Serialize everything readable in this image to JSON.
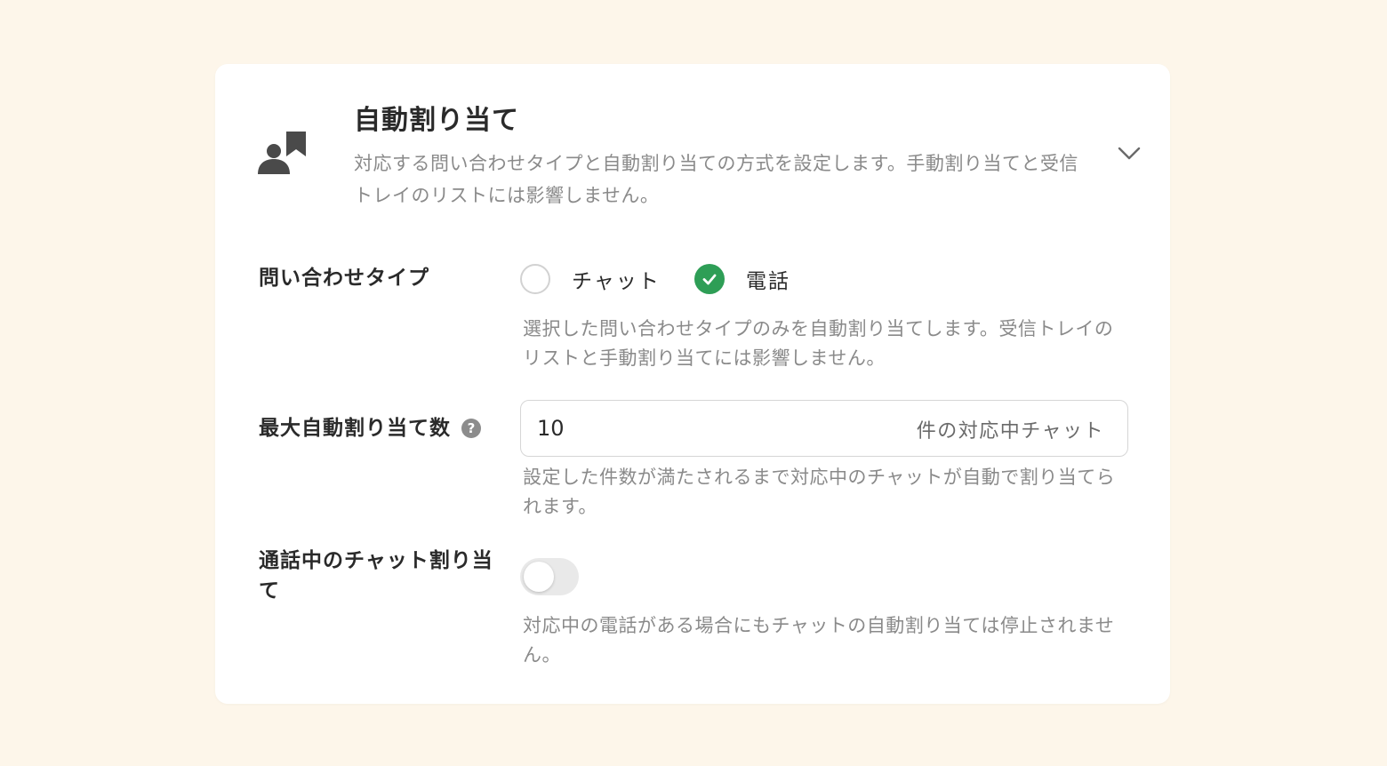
{
  "header": {
    "title": "自動割り当て",
    "description": "対応する問い合わせタイプと自動割り当ての方式を設定します。手動割り当てと受信トレイのリストには影響しません。",
    "icon": "user-bookmark-icon",
    "toggle_icon": "chevron-down-icon"
  },
  "inquiry_type": {
    "label": "問い合わせタイプ",
    "options": [
      {
        "label": "チャット",
        "checked": false
      },
      {
        "label": "電話",
        "checked": true
      }
    ],
    "hint": "選択した問い合わせタイプのみを自動割り当てします。受信トレイのリストと手動割り当てには影響しません。"
  },
  "max_assign": {
    "label": "最大自動割り当て数",
    "help_symbol": "?",
    "value": "10",
    "suffix": "件の対応中チャット",
    "hint": "設定した件数が満たされるまで対応中のチャットが自動で割り当てられます。"
  },
  "call_chat_assign": {
    "label": "通話中のチャット割り当て",
    "enabled": false,
    "hint": "対応中の電話がある場合にもチャットの自動割り当ては停止されません。"
  },
  "colors": {
    "background": "#fdf6ea",
    "accent_check": "#2e9e56",
    "icon": "#4a4a4a"
  }
}
